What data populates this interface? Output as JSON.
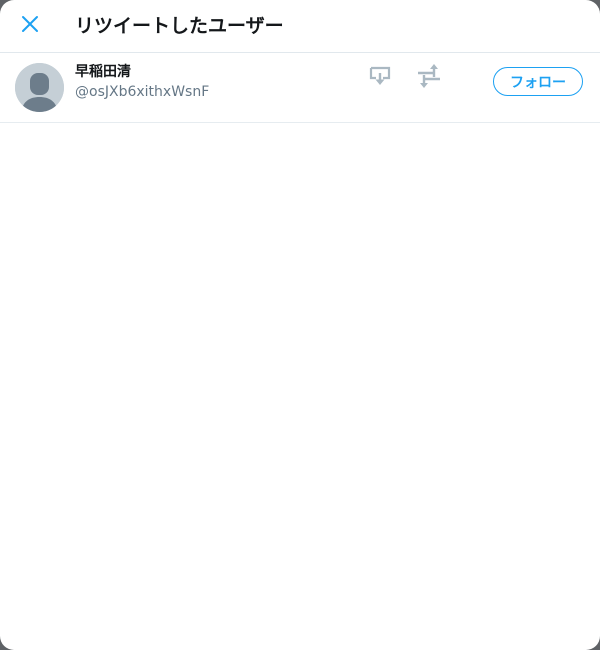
{
  "header": {
    "title": "リツイートしたユーザー",
    "close_icon": "close-icon"
  },
  "users": [
    {
      "name": "早稲田清",
      "handle": "@osJXb6xithxWsnF",
      "avatar": "default-avatar",
      "actions": [
        "dm-icon",
        "retweet-icon"
      ],
      "follow_label": "フォロー"
    }
  ],
  "colors": {
    "accent": "#1da1f2",
    "icon_gray": "#aab8c2",
    "text_primary": "#14171a",
    "text_secondary": "#657786",
    "border": "#e6ecf0"
  }
}
